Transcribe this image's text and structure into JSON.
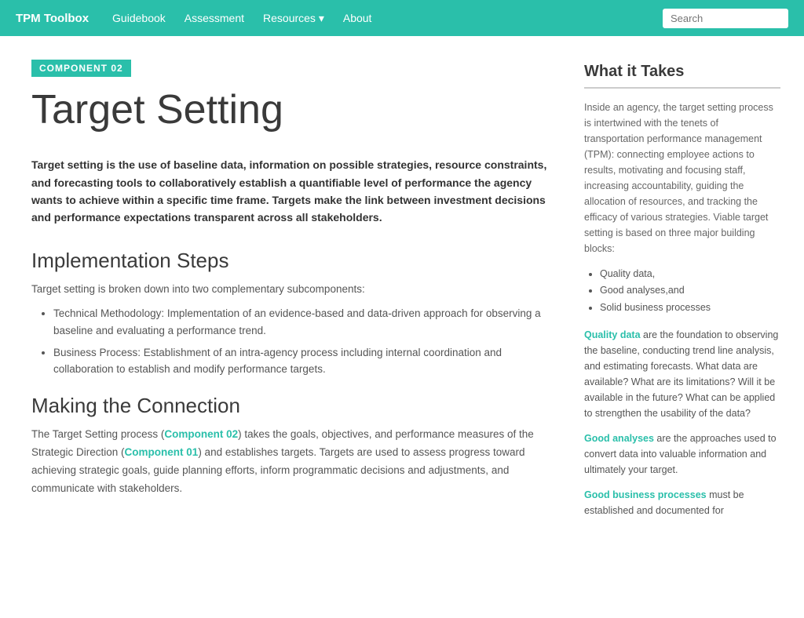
{
  "nav": {
    "brand": "TPM Toolbox",
    "links": [
      "Guidebook",
      "Assessment",
      "Resources ▾",
      "About"
    ],
    "search_placeholder": "Search"
  },
  "component_badge": "COMPONENT 02",
  "page_title": "Target Setting",
  "intro_text": "Target setting is the use of baseline data, information on possible strategies, resource constraints, and forecasting tools to collaboratively establish a quantifiable level of performance the agency wants to achieve within a specific time frame. Targets make the link between investment decisions and performance expectations transparent across all stakeholders.",
  "implementation": {
    "heading": "Implementation Steps",
    "intro": "Target setting is broken down into two complementary subcomponents:",
    "bullets": [
      "Technical Methodology: Implementation of an evidence-based and data-driven approach for observing a baseline and evaluating a performance trend.",
      "Business Process: Establishment of an intra-agency process including internal coordination and collaboration to establish and modify performance targets."
    ]
  },
  "connection": {
    "heading": "Making the Connection",
    "text_before_link1": "The Target Setting process (",
    "link1": "Component 02",
    "text_between": ") takes the goals, objectives, and performance measures of the Strategic Direction (",
    "link2": "Component 01",
    "text_after": ") and establishes targets. Targets are used to assess progress toward achieving strategic goals, guide planning efforts, inform programmatic decisions and adjustments, and communicate with stakeholders."
  },
  "sidebar": {
    "title": "What it Takes",
    "intro": "Inside an agency, the target setting process is intertwined with the tenets of transportation performance management (TPM): connecting employee actions to results, motivating and focusing staff, increasing accountability, guiding the allocation of resources, and tracking the efficacy of various strategies. Viable target setting is based on three major building blocks:",
    "bullets": [
      "Quality data,",
      "Good analyses,and",
      "Solid business processes"
    ],
    "sections": [
      {
        "term": "Quality data",
        "text": " are the foundation to observing the baseline, conducting trend line analysis, and estimating forecasts. What data are available? What are its limitations? Will it be available in the future? What can be applied to strengthen the usability of the data?"
      },
      {
        "term": "Good analyses",
        "text": " are the approaches used to convert data into valuable information and ultimately your target."
      },
      {
        "term": "Good business processes",
        "text": " must be established and documented for"
      }
    ]
  }
}
